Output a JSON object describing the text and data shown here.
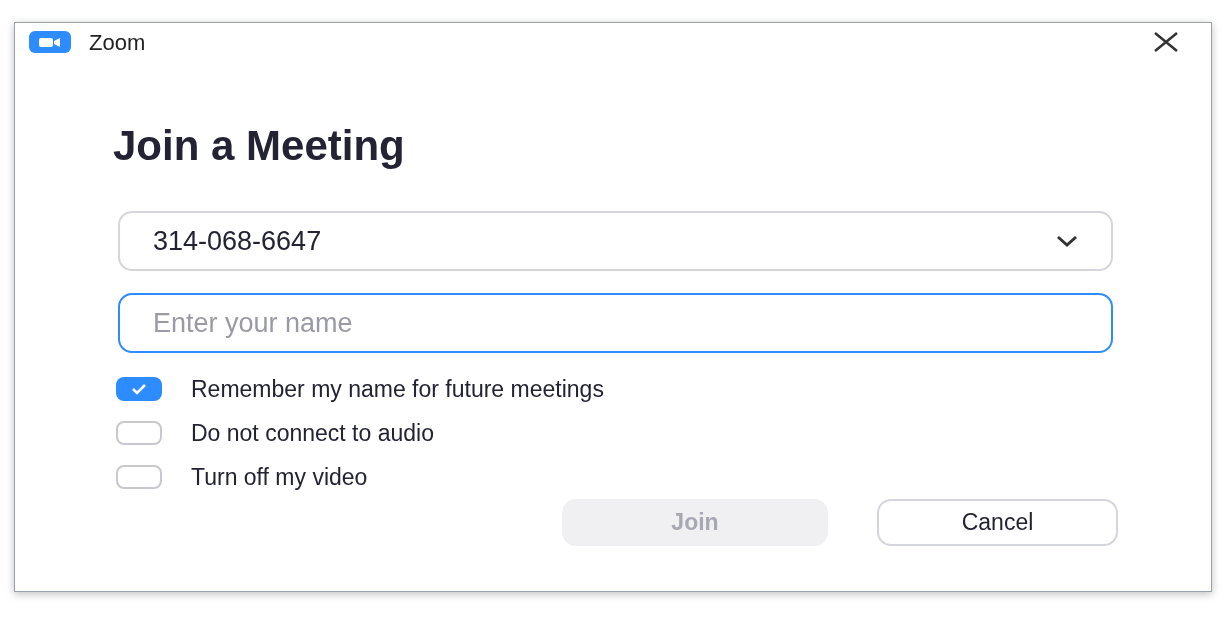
{
  "window": {
    "title": "Zoom"
  },
  "heading": "Join a Meeting",
  "meeting_id": {
    "value": "314-068-6647"
  },
  "name_field": {
    "placeholder": "Enter your name",
    "focused": true
  },
  "options": [
    {
      "label": "Remember my name for future meetings",
      "checked": true
    },
    {
      "label": "Do not connect to audio",
      "checked": false
    },
    {
      "label": "Turn off my video",
      "checked": false
    }
  ],
  "buttons": [
    {
      "label": "Join",
      "disabled": true
    },
    {
      "label": "Cancel",
      "disabled": false
    }
  ]
}
